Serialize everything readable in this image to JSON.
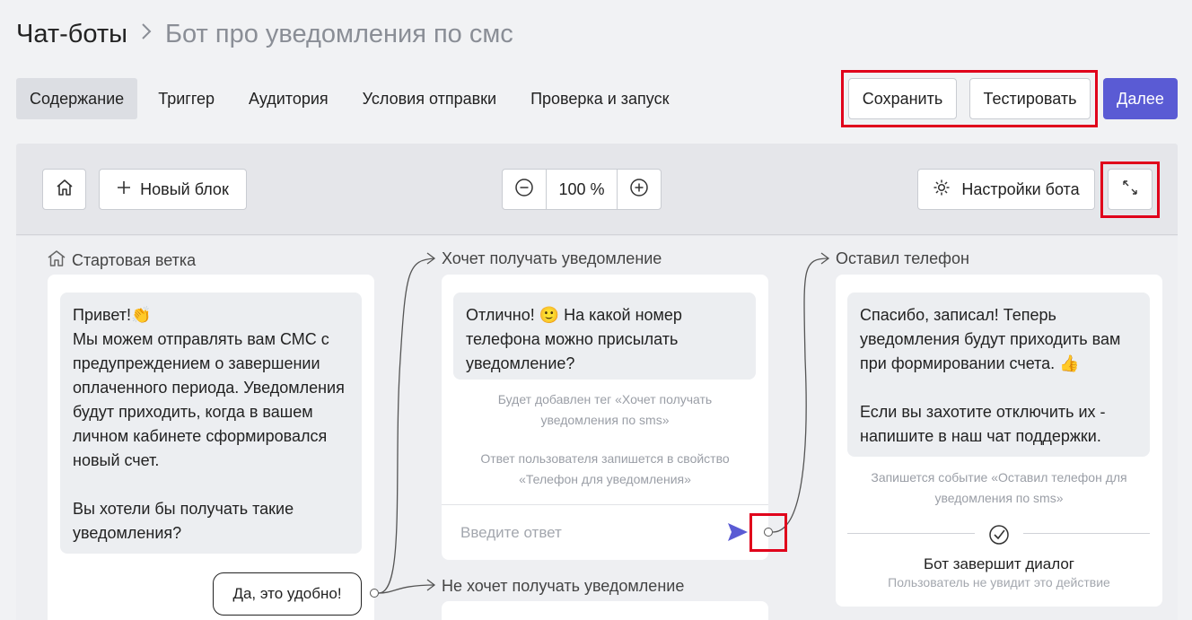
{
  "breadcrumb": {
    "root": "Чат-боты",
    "current": "Бот про уведомления по смс"
  },
  "tabs": [
    {
      "label": "Содержание",
      "active": true
    },
    {
      "label": "Триггер"
    },
    {
      "label": "Аудитория"
    },
    {
      "label": "Условия отправки"
    },
    {
      "label": "Проверка и запуск"
    }
  ],
  "actions": {
    "save": "Сохранить",
    "test": "Тестировать",
    "next": "Далее"
  },
  "toolbar": {
    "new_block": "Новый блок",
    "zoom": "100 %",
    "settings": "Настройки бота"
  },
  "branches": {
    "start": {
      "title": "Стартовая ветка",
      "message": "Привет!👏\nМы можем отправлять вам СМС с предупреждением о завершении оплаченного периода. Уведомления будут приходить, когда в вашем личном кабинете сформировался новый счет.\n\nВы хотели бы получать такие уведомления?",
      "reply": "Да, это удобно!"
    },
    "wants": {
      "title": "Хочет получать уведомление",
      "message": "Отлично! 🙂 На какой номер телефона можно присылать уведомление?",
      "note1": "Будет добавлен тег «Хочет получать уведомления по sms»",
      "note2": "Ответ пользователя запишется в свойство «Телефон для уведомления»",
      "input_placeholder": "Введите ответ"
    },
    "left_phone": {
      "title": "Оставил телефон",
      "message": "Спасибо, записал! Теперь уведомления будут приходить вам при формировании счета. 👍\n\nЕсли вы захотите отключить их - напишите в наш чат поддержки.",
      "note": "Запишется событие «Оставил телефон для уведомления по sms»",
      "end_title": "Бот завершит диалог",
      "end_subtitle": "Пользователь не увидит это действие"
    },
    "not_wants": {
      "title": "Не хочет получать уведомление"
    }
  },
  "colors": {
    "accent": "#5a5bd4",
    "highlight": "#e0001b"
  }
}
